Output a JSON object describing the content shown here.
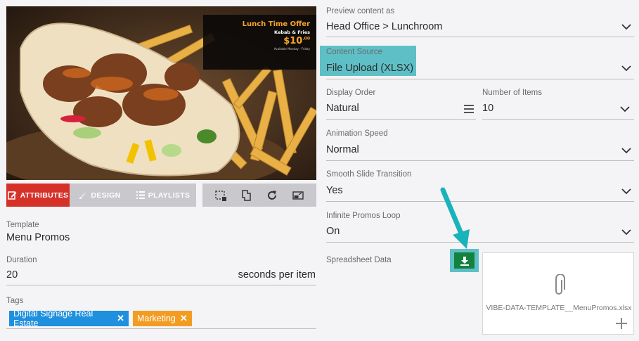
{
  "preview": {
    "offer_title": "Lunch Time Offer",
    "offer_subtitle": "Kebab & Fries",
    "offer_currency": "$",
    "offer_price": "10",
    "offer_cents": ".00",
    "offer_note": "Available Monday - Friday"
  },
  "tabs": {
    "attributes": "ATTRIBUTES",
    "design": "DESIGN",
    "playlists": "PLAYLISTS"
  },
  "left": {
    "template_label": "Template",
    "template_value": "Menu Promos",
    "duration_label": "Duration",
    "duration_value": "20",
    "duration_unit": "seconds per item",
    "tags_label": "Tags",
    "tags": [
      "Digital Signage Real Estate",
      "Marketing"
    ]
  },
  "right": {
    "preview_label": "Preview content as",
    "preview_value": "Head Office > Lunchroom",
    "source_label": "Content Source",
    "source_value": "File Upload (XLSX)",
    "order_label": "Display Order",
    "order_value": "Natural",
    "items_label": "Number of Items",
    "items_value": "10",
    "speed_label": "Animation Speed",
    "speed_value": "Normal",
    "smooth_label": "Smooth Slide Transition",
    "smooth_value": "Yes",
    "loop_label": "Infinite Promos Loop",
    "loop_value": "On",
    "sheet_label": "Spreadsheet Data",
    "file_name": "VIBE-DATA-TEMPLATE__MenuPromos.xlsx"
  },
  "colors": {
    "attributes_tab": "#d63129",
    "inactive_tab": "#c9c8cc",
    "highlight": "#5ec0c6",
    "download": "#14813e",
    "tag_blue": "#1e90dd",
    "tag_orange": "#f39c22"
  }
}
